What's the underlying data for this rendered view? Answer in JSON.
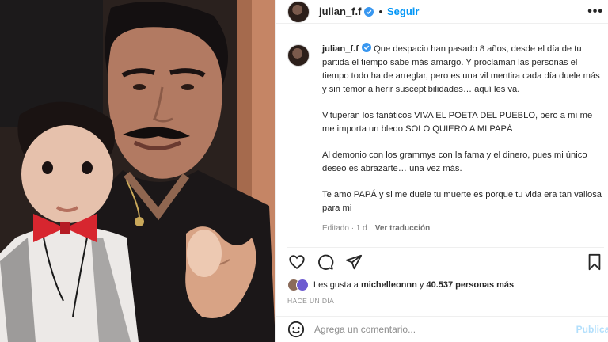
{
  "header": {
    "username": "julian_f.f",
    "separator": "•",
    "follow_label": "Seguir",
    "more_label": "•••"
  },
  "caption": {
    "username": "julian_f.f",
    "paragraphs": [
      "Que despacio han pasado 8 años, desde el día de tu partida el tiempo sabe más amargo. Y proclaman las personas el tiempo todo ha de arreglar, pero es una vil mentira cada día duele más y sin temor a herir susceptibilidades… aquí les va.",
      "Vituperan los fanáticos VIVA EL POETA DEL PUEBLO, pero a mí me me importa un bledo SOLO QUIERO A MI PAPÁ",
      "Al demonio con los grammys con la fama y el dinero, pues mi único deseo es abrazarte… una vez más.",
      "Te amo PAPÁ y si me duele tu muerte es porque tu vida era tan valiosa para mi"
    ],
    "edited": "Editado · 1 d",
    "translate": "Ver traducción"
  },
  "likes": {
    "prefix": "Les gusta a ",
    "user": "michelleonnn",
    "middle": " y ",
    "count": "40.537 personas más"
  },
  "time_ago": "HACE UN DÍA",
  "comment": {
    "placeholder": "Agrega un comentario...",
    "post_label": "Publicar"
  },
  "colors": {
    "accent": "#0095f6",
    "verified": "#3897f0"
  },
  "icons": {
    "like": "heart-icon",
    "comment": "comment-icon",
    "share": "share-icon",
    "save": "bookmark-icon",
    "emoji": "emoji-icon"
  }
}
